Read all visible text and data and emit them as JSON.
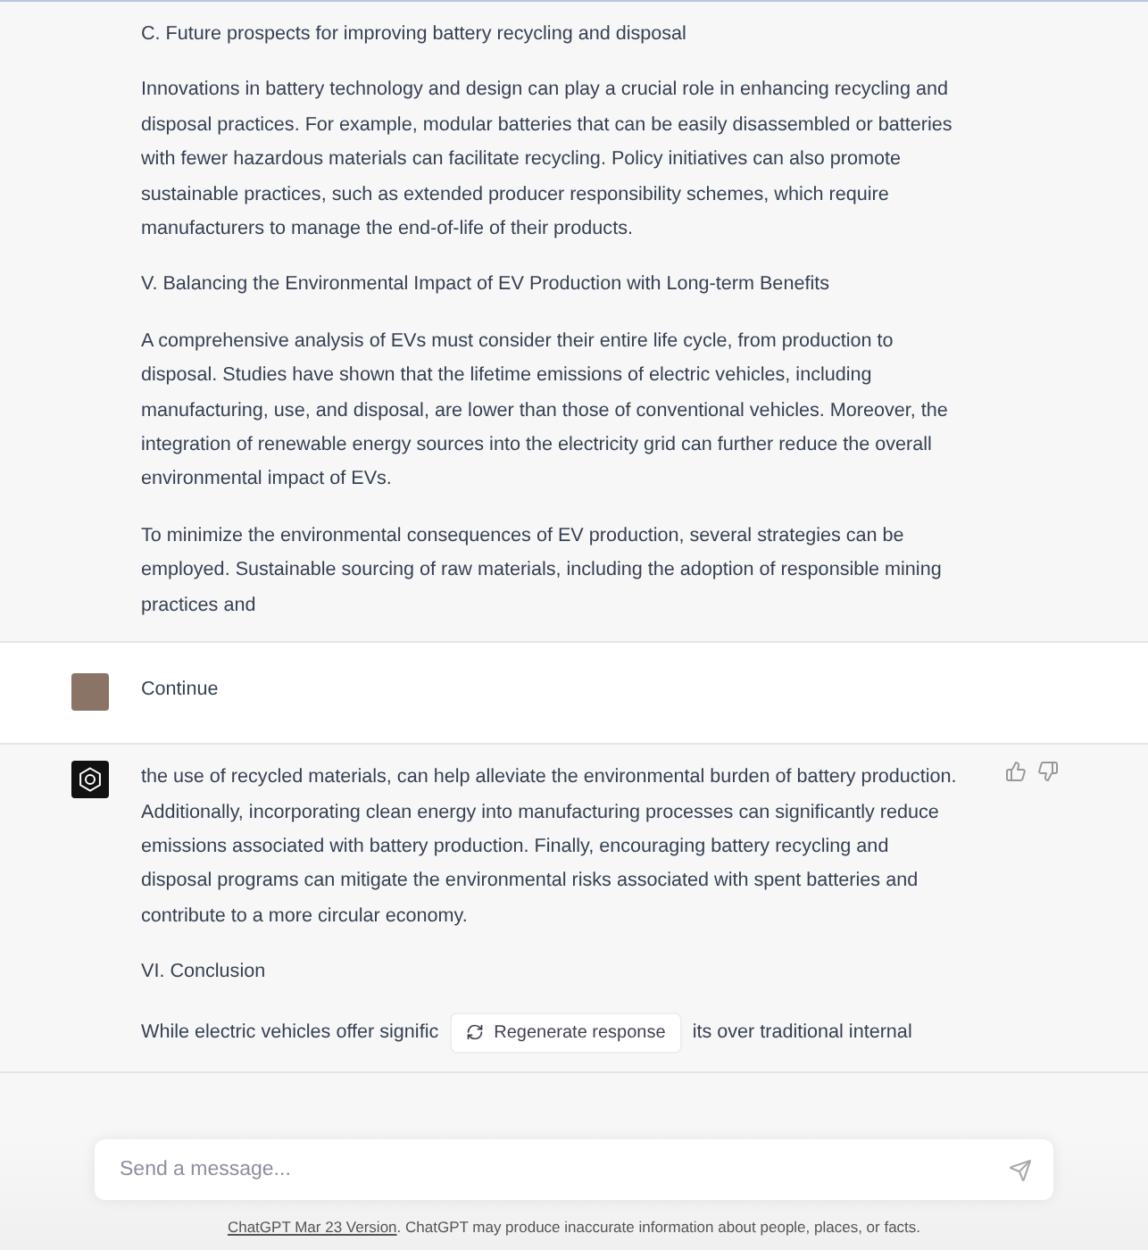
{
  "messages": [
    {
      "kind": "reply_tail",
      "feedback": false,
      "paragraphs": [
        {
          "kind": "text",
          "text": "C. Future prospects for improving battery recycling and disposal"
        },
        {
          "kind": "text",
          "text": "Innovations in battery technology and design can play a crucial role in enhancing recycling and disposal practices. For example, modular batteries that can be easily disassembled or batteries with fewer hazardous materials can facilitate recycling. Policy initiatives can also promote sustainable practices, such as extended producer responsibility schemes, which require manufacturers to manage the end-of-life of their products."
        },
        {
          "kind": "text",
          "text": "V. Balancing the Environmental Impact of EV Production with Long-term Benefits"
        },
        {
          "kind": "text",
          "text": "A comprehensive analysis of EVs must consider their entire life cycle, from production to disposal. Studies have shown that the lifetime emissions of electric vehicles, including manufacturing, use, and disposal, are lower than those of conventional vehicles. Moreover, the integration of renewable energy sources into the electricity grid can further reduce the overall environmental impact of EVs."
        },
        {
          "kind": "text",
          "text": "To minimize the environmental consequences of EV production, several strategies can be employed. Sustainable sourcing of raw materials, including the adoption of responsible mining practices and"
        }
      ]
    },
    {
      "kind": "prompt",
      "feedback": false,
      "paragraphs": [
        {
          "kind": "text",
          "text": "Continue"
        }
      ]
    },
    {
      "kind": "reply",
      "feedback": true,
      "paragraphs": [
        {
          "kind": "text",
          "text": "the use of recycled materials, can help alleviate the environmental burden of battery production. Additionally, incorporating clean energy into manufacturing processes can significantly reduce emissions associated with battery production. Finally, encouraging battery recycling and disposal programs can mitigate the environmental risks associated with spent batteries and contribute to a more circular economy."
        },
        {
          "kind": "text",
          "text": "VI. Conclusion"
        },
        {
          "kind": "covered",
          "before": "While electric vehicles offer signific",
          "after": "its over traditional internal"
        }
      ]
    }
  ],
  "regenerate_button": "Regenerate response",
  "composer": {
    "placeholder": "Send a message..."
  },
  "footer": {
    "link": "ChatGPT Mar 23 Version",
    "text": ". ChatGPT may produce inaccurate information about people, places, or facts."
  }
}
